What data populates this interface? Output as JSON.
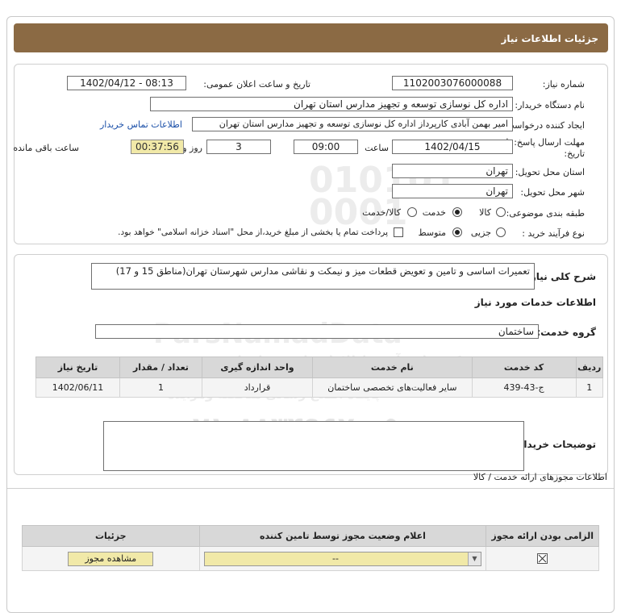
{
  "header": {
    "title": "جزئیات اطلاعات نیاز"
  },
  "details": {
    "need_number_label": "شماره نیاز:",
    "need_number": "1102003076000088",
    "announce_label": "تاریخ و ساعت اعلان عمومی:",
    "announce_value": "1402/04/12 - 08:13",
    "buyer_org_label": "نام دستگاه خریدار:",
    "buyer_org": "اداره کل نوسازی  توسعه و تجهیز مدارس استان تهران",
    "requester_label": "ایجاد کننده درخواست:",
    "requester": "امیر بهمن آبادی کارپرداز اداره کل نوسازی  توسعه و تجهیز مدارس استان تهران",
    "contact_link": "اطلاعات تماس خریدار",
    "deadline_label_1": "مهلت ارسال پاسخ: تا",
    "deadline_label_2": "تاریخ:",
    "deadline_date": "1402/04/15",
    "time_label": "ساعت",
    "deadline_time": "09:00",
    "days_value": "3",
    "days_label": "روز و",
    "remaining_value": "00:37:56",
    "remaining_label": "ساعت باقی مانده",
    "province_label": "استان محل تحویل:",
    "province": "تهران",
    "city_label": "شهر محل تحویل:",
    "city": "تهران",
    "category_label": "طبقه بندی موضوعی:",
    "category_options": [
      "کالا",
      "خدمت",
      "کالا/خدمت"
    ],
    "process_label": "نوع فرآیند خرید :",
    "process_options": [
      "جزیی",
      "متوسط"
    ],
    "payment_note": "پرداخت تمام یا بخشی از مبلغ خرید،از محل \"اسناد خزانه اسلامی\" خواهد بود."
  },
  "description": {
    "label": "شرح کلی نیاز:",
    "text": "تعمیرات اساسی  و تامین و تعویض قطعات میز و نیمکت و نقاشی مدارس شهرستان تهران(مناطق 15 و 17)",
    "services_heading": "اطلاعات خدمات مورد نیاز",
    "group_label": "گروه خدمت:",
    "group_value": "ساختمان"
  },
  "services_table": {
    "headers": [
      "ردیف",
      "کد خدمت",
      "نام خدمت",
      "واحد اندازه گیری",
      "تعداد / مقدار",
      "تاریخ نیاز"
    ],
    "rows": [
      [
        "1",
        "ج-43-439",
        "سایر فعالیت‌های تخصصی ساختمان",
        "قرارداد",
        "1",
        "1402/06/11"
      ]
    ]
  },
  "buyer_notes": {
    "label": "توضیحات خریدار:",
    "value": ""
  },
  "permits": {
    "title": "اطلاعات مجوزهای ارائه خدمت / کالا",
    "headers": [
      "الزامی بودن ارائه مجوز",
      "اعلام وضعیت مجوز توسط تامین کننده",
      "جزئیات"
    ],
    "select_value": "--",
    "view_button": "مشاهده مجوز"
  },
  "watermark": {
    "brand": "ParsNamadData",
    "line1": "مرکز فراهم آوری اطلاعات پارس نماد داده",
    "line2": "پایگاه اطلاع رسانی مناقصه ومزایده",
    "phone": "۰۲۱-۸۸۳۴۹۶۷۰-۵"
  },
  "colors": {
    "title_bar": "#8b6a44",
    "remaining_bg": "#f1e9a8",
    "link": "#1a4fa8"
  }
}
